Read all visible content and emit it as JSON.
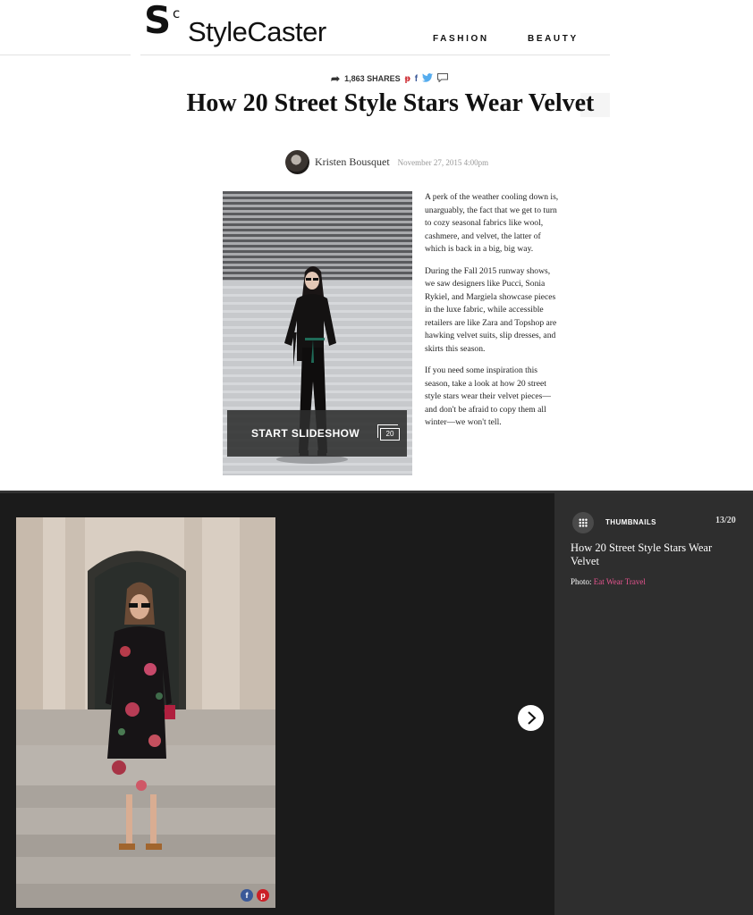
{
  "header": {
    "logo_mark": "S",
    "logo_sup": "c",
    "logo_text": "StyleCaster",
    "nav": [
      "FASHION",
      "BEAUTY"
    ]
  },
  "share_bar": {
    "count": "1,863 SHARES",
    "icons": [
      "share-arrow-icon",
      "pinterest-icon",
      "facebook-icon",
      "twitter-icon",
      "comment-icon"
    ]
  },
  "article": {
    "title": "How 20 Street Style Stars Wear Velvet",
    "author": "Kristen Bousquet",
    "date": "November 27, 2015  4:00pm",
    "paragraphs": [
      "A perk of the weather cooling down is, unarguably, the fact that we get to turn to cozy seasonal fabrics like wool, cashmere, and velvet, the latter of which is back in a big, big way.",
      "During the Fall 2015 runway shows, we saw designers like Pucci, Sonia Rykiel, and Margiela showcase pieces in the luxe fabric, while accessible retailers are like Zara and Topshop are hawking velvet suits, slip dresses, and skirts this season.",
      "If you need some inspiration this season, take a look at how 20 street style stars wear their velvet pieces—and don't be afraid to copy them all winter—we won't tell."
    ]
  },
  "hero": {
    "button_label": "START SLIDESHOW",
    "slide_total": "20"
  },
  "slideshow": {
    "thumbnails_label": "THUMBNAILS",
    "counter": "13/20",
    "title": "How 20 Street Style Stars Wear Velvet",
    "photo_label": "Photo:",
    "photo_source": "Eat Wear Travel",
    "social": [
      "f",
      "p"
    ]
  },
  "colors": {
    "pinterest": "#cb2027",
    "facebook": "#3b5998",
    "twitter": "#55acee",
    "credit_link": "#e6548f",
    "slider_bg": "#1b1b1b",
    "panel_bg": "#2e2e2e"
  }
}
